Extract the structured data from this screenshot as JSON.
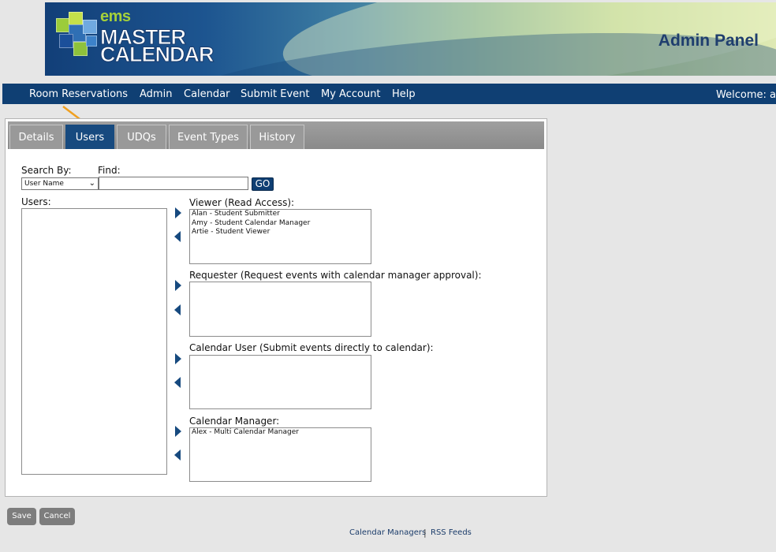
{
  "colors": {
    "navy": "#0f3f73",
    "active_tab": "#174a7f",
    "inactive_tab": "#999999",
    "annotation_arrow": "#f0a020",
    "logo_green": "#a5d13a"
  },
  "banner": {
    "logo_small": "ems",
    "logo_line1": "MASTER",
    "logo_line2": "CALENDAR",
    "title": "Admin Panel"
  },
  "nav": {
    "items": [
      "Room Reservations",
      "Admin",
      "Calendar",
      "Submit Event",
      "My Account",
      "Help"
    ],
    "welcome": "Welcome: a"
  },
  "tabs": {
    "items": [
      "Details",
      "Users",
      "UDQs",
      "Event Types",
      "History"
    ],
    "active": "Users"
  },
  "search": {
    "search_by_label": "Search By:",
    "search_by_value": "User Name",
    "find_label": "Find:",
    "find_value": "",
    "go_label": "GO"
  },
  "users": {
    "label": "Users:",
    "items": []
  },
  "roles": {
    "viewer": {
      "label": "Viewer (Read Access):",
      "items": [
        "Alan - Student Submitter",
        "Amy - Student Calendar Manager",
        "Artie - Student Viewer"
      ]
    },
    "requester": {
      "label": "Requester (Request events with calendar manager approval):",
      "items": []
    },
    "calendar_user": {
      "label": "Calendar User (Submit events directly to calendar):",
      "items": []
    },
    "calendar_manager": {
      "label": "Calendar Manager:",
      "items": [
        "Alex - Multi Calendar Manager"
      ]
    }
  },
  "actions": {
    "save": "Save",
    "cancel": "Cancel"
  },
  "footer": {
    "links": [
      "Calendar Managers",
      "RSS Feeds"
    ],
    "separator": "|"
  }
}
